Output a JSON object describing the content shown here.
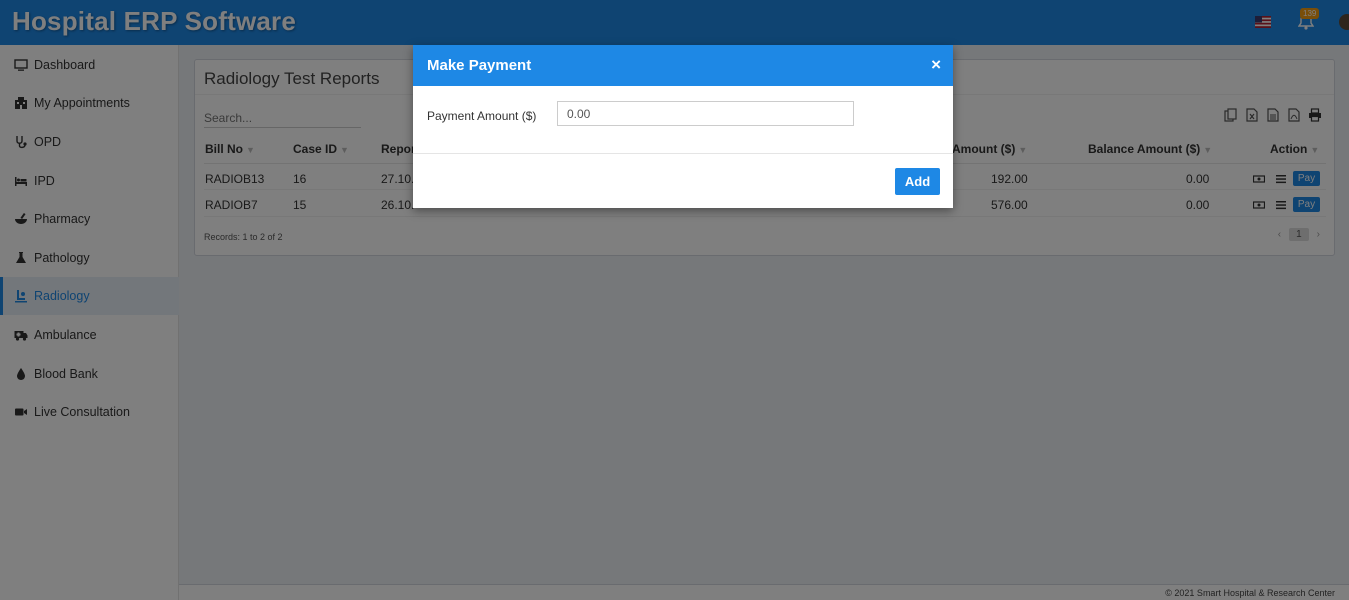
{
  "header": {
    "brand": "Hospital ERP Software",
    "notification_count": "139"
  },
  "sidebar": {
    "items": [
      {
        "label": "Dashboard",
        "icon": "desktop-icon"
      },
      {
        "label": "My Appointments",
        "icon": "hospital-icon"
      },
      {
        "label": "OPD",
        "icon": "stethoscope-icon"
      },
      {
        "label": "IPD",
        "icon": "bed-icon"
      },
      {
        "label": "Pharmacy",
        "icon": "mortar-pestle-icon"
      },
      {
        "label": "Pathology",
        "icon": "flask-icon"
      },
      {
        "label": "Radiology",
        "icon": "xray-icon",
        "active": true
      },
      {
        "label": "Ambulance",
        "icon": "ambulance-icon"
      },
      {
        "label": "Blood Bank",
        "icon": "tint-icon"
      },
      {
        "label": "Live Consultation",
        "icon": "video-icon"
      }
    ]
  },
  "panel": {
    "title": "Radiology Test Reports",
    "search_placeholder": "Search...",
    "columns": [
      "Bill No",
      "Case ID",
      "Repor",
      "Amount ($)",
      "Balance Amount ($)",
      "Action"
    ],
    "rows": [
      {
        "bill_no": "RADIOB13",
        "case_id": "16",
        "report_date": "27.10.",
        "amount": "192.00",
        "balance": "0.00",
        "pay_label": "Pay"
      },
      {
        "bill_no": "RADIOB7",
        "case_id": "15",
        "report_date": "26.10.",
        "amount": "576.00",
        "balance": "0.00",
        "pay_label": "Pay"
      }
    ],
    "records": "Records: 1 to 2 of 2",
    "page": "1"
  },
  "footer": {
    "text": "© 2021 Smart Hospital & Research Center"
  },
  "modal": {
    "title": "Make Payment",
    "close_label": "×",
    "field_label": "Payment Amount ($)",
    "field_value": "0.00",
    "add_label": "Add"
  },
  "colors": {
    "primary": "#1e88e5",
    "badge": "#f39c12"
  }
}
